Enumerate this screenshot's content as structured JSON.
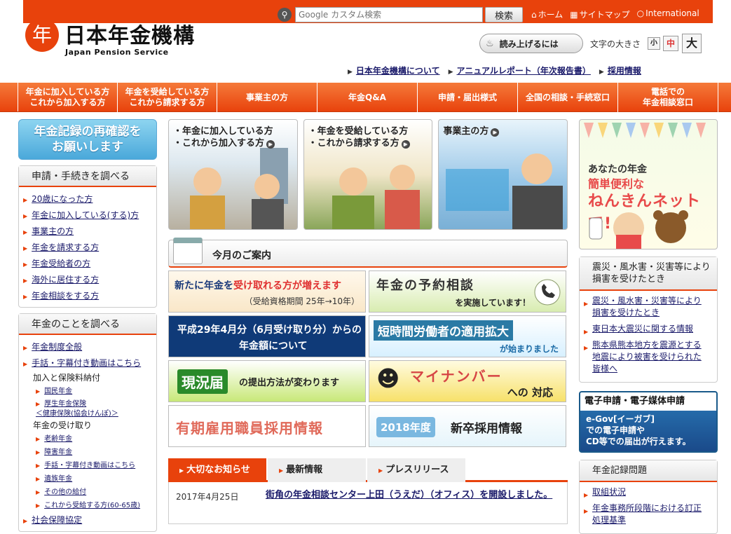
{
  "header": {
    "logo_mark": "年",
    "logo_jp": "日本年金機構",
    "logo_en": "Japan Pension Service",
    "search_placeholder": "Google カスタム検索",
    "search_button": "検索",
    "links": [
      {
        "icon": "home-icon",
        "label": "ホーム"
      },
      {
        "icon": "sitemap-icon",
        "label": "サイトマップ"
      },
      {
        "icon": "globe-icon",
        "label": "International"
      }
    ],
    "read_aloud": "読み上げるには",
    "font_size_label": "文字の大きさ",
    "font_small": "小",
    "font_medium": "中",
    "font_large": "大",
    "sublinks": [
      "日本年金機構について",
      "アニュアルレポート（年次報告書）",
      "採用情報"
    ]
  },
  "gnav": [
    "年金に加入している方\nこれから加入する方",
    "年金を受給している方\nこれから請求する方",
    "事業主の方",
    "年金Q&A",
    "申請・届出様式",
    "全国の相談・手続窓口",
    "電話での\n年金相談窓口"
  ],
  "left": {
    "banner": "年金記録の再確認を\nお願いします",
    "box1_title": "申請・手続きを調べる",
    "box1_items": [
      "20歳になった方",
      "年金に加入している(する)方",
      "事業主の方",
      "年金を請求する方",
      "年金受給者の方",
      "海外に居住する方",
      "年金相談をする方"
    ],
    "box2_title": "年金のことを調べる",
    "box2_items": [
      "年金制度全般",
      "手話・字幕付き動画はこちら"
    ],
    "box2_sub1": "加入と保険料納付",
    "box2_sub1_items": [
      "国民年金",
      "厚生年金保険\n＜健康保険(協会けんぽ)＞"
    ],
    "box2_sub2": "年金の受け取り",
    "box2_sub2_items": [
      "老齢年金",
      "障害年金",
      "手話・字幕付き動画はこちら",
      "遺族年金",
      "その他の給付",
      "これから受給する方(60-65歳)"
    ],
    "box2_last": "社会保障協定"
  },
  "center": {
    "cards": [
      "・年金に加入している方\n・これから加入する方",
      "・年金を受給している方\n・これから請求する方",
      "事業主の方"
    ],
    "month_title": "今月のご案内",
    "t1a_pre": "新たに年金を",
    "t1a_red": "受け取れる方が増えます",
    "t1b": "（受給資格期間 25年→10年）",
    "t2a": "年金の予約相談",
    "t2b": "を実施しています！",
    "t3a": "平成29年4月分（6月受け取り分）からの",
    "t3b": "年金額について",
    "t4a": "短時間労働者の適用拡大",
    "t4b": "が始まりました",
    "t5a": "現況届",
    "t5b": "の提出方法が変わります",
    "t6a": "マイナンバー",
    "t6b": "への 対応",
    "t7a": "有期雇用職員採用情報",
    "t8a": "2018年度",
    "t8b": "新卒採用情報",
    "tabs": [
      "大切なお知らせ",
      "最新情報",
      "プレスリリース"
    ],
    "news_date": "2017年4月25日",
    "news_title": "街角の年金相談センター上田（うえだ）（オフィス）を開設しました。"
  },
  "right": {
    "n_a": "あなたの年金",
    "n_b": "簡単便利な",
    "n_c": "ねんきんネットで!",
    "box1_title": "震災・風水害・災害等により\n損害を受けたとき",
    "box1_items": [
      "震災・風水害・災害等により\n損害を受けたとき",
      "東日本大震災に関する情報",
      "熊本県熊本地方を震源とする\n地震により被害を受けられた\n皆様へ"
    ],
    "egov_title": "電子申請・電子媒体申請",
    "egov_body": "e-Gov[イーガブ]\nでの電子申請や\nCD等での届出が行えます。",
    "box2_title": "年金記録問題",
    "box2_items": [
      "取組状況",
      "年金事務所段階における訂正\n処理基準"
    ]
  }
}
